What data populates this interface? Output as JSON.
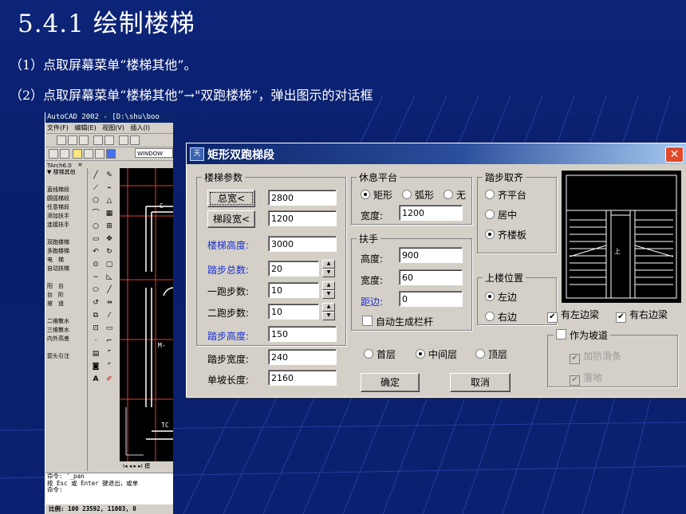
{
  "slide": {
    "title": "5.4.1 绘制楼梯",
    "bullets": [
      "（1）点取屏幕菜单“楼梯其他”。",
      "（2）点取屏幕菜单“楼梯其他”→\"双跑楼梯”，弹出图示的对话框"
    ]
  },
  "autocad": {
    "title": "AutoCAD 2002 - [D:\\shu\\boo",
    "menu": [
      "文件(F)",
      "编辑(E)",
      "视图(V)",
      "插入(I)"
    ],
    "workspace": "WINDOW",
    "panel_header": "TArch6.0",
    "panel_items": [
      "▼ 楼梯其他",
      "",
      "直线梯段",
      "圆弧梯段",
      "任意梯段",
      "添加扶手",
      "连接扶手",
      "",
      "双跑楼梯",
      "多跑楼梯",
      "电　梯",
      "自动扶梯",
      "",
      "阳　台",
      "台　阶",
      "坡　道",
      "",
      "二维散水",
      "三维散水",
      "内外高差",
      "",
      "箭头引注"
    ],
    "command_lines": [
      "命令: '_pan",
      "按 Esc 或 Enter 键退出，或单",
      "命令:"
    ],
    "status": "比例: 100 23592, 11003, 0"
  },
  "dialog": {
    "title": "矩形双跑梯段",
    "groups": {
      "stair_params": "楼梯参数",
      "landing": "休息平台",
      "handrail": "扶手",
      "tread_align": "踏步取齐",
      "up_position": "上楼位置",
      "slope": "作为坡道"
    },
    "buttons": {
      "total_width": "总宽<",
      "flight_width": "梯段宽<",
      "ok": "确定",
      "cancel": "取消"
    },
    "fields": {
      "total_width": "2800",
      "flight_width": "1200",
      "stair_height_label": "楼梯高度:",
      "stair_height": "3000",
      "total_steps_label": "踏步总数:",
      "total_steps": "20",
      "run1_steps_label": "一跑步数:",
      "run1_steps": "10",
      "run2_steps_label": "二跑步数:",
      "run2_steps": "10",
      "step_height_label": "踏步高度:",
      "step_height": "150",
      "step_width_label": "踏步宽度:",
      "step_width": "240",
      "slope_length_label": "单坡长度:",
      "slope_length": "2160",
      "landing_width_label": "宽度:",
      "landing_width": "1200",
      "rail_height_label": "高度:",
      "rail_height": "900",
      "rail_width_label": "宽度:",
      "rail_width": "60",
      "rail_offset_label": "距边:",
      "rail_offset": "0"
    },
    "landing_shapes": [
      {
        "label": "矩形",
        "selected": true
      },
      {
        "label": "弧形",
        "selected": false
      },
      {
        "label": "无",
        "selected": false
      }
    ],
    "tread_options": [
      {
        "label": "齐平台",
        "selected": false
      },
      {
        "label": "居中",
        "selected": false
      },
      {
        "label": "齐楼板",
        "selected": true
      }
    ],
    "up_options": [
      {
        "label": "左边",
        "selected": true
      },
      {
        "label": "右边",
        "selected": false
      }
    ],
    "floor_options": [
      {
        "label": "首层",
        "selected": false
      },
      {
        "label": "中间层",
        "selected": true
      },
      {
        "label": "顶层",
        "selected": false
      }
    ],
    "auto_rail": {
      "label": "自动生成栏杆",
      "checked": false
    },
    "left_beam": {
      "label": "有左边梁",
      "checked": true
    },
    "right_beam": {
      "label": "有右边梁",
      "checked": true
    },
    "anti_slip": {
      "label": "加防滑条",
      "checked": true
    },
    "grounded": {
      "label": "落地",
      "checked": true
    },
    "preview_label": "上"
  }
}
